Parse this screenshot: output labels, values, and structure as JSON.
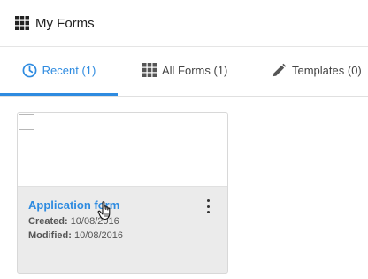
{
  "header": {
    "title": "My Forms",
    "icon": "grid-icon"
  },
  "tabs": [
    {
      "label": "Recent (1)",
      "icon": "clock-icon",
      "active": true
    },
    {
      "label": "All Forms (1)",
      "icon": "grid-icon",
      "active": false
    },
    {
      "label": "Templates (0)",
      "icon": "pencil-icon",
      "active": false
    }
  ],
  "colors": {
    "accent": "#2e8be0",
    "card_bg": "#ebebeb"
  },
  "card": {
    "name": "Application form",
    "created_label": "Created:",
    "created_value": "10/08/2016",
    "modified_label": "Modified:",
    "modified_value": "10/08/2016",
    "menu_icon": "more-vertical-icon"
  }
}
